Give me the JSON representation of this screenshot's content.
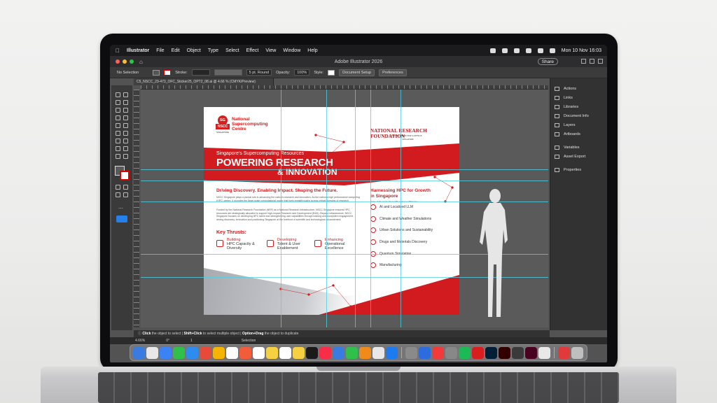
{
  "menubar": {
    "app_name": "Illustrator",
    "items": [
      "File",
      "Edit",
      "Object",
      "Type",
      "Select",
      "Effect",
      "View",
      "Window",
      "Help"
    ],
    "datetime": "Mon 10 Nov  16:03"
  },
  "window": {
    "title": "Adobe Illustrator 2026",
    "share_label": "Share"
  },
  "controlbar": {
    "selection": "No Selection",
    "stroke_label": "Stroke:",
    "brush": "5 pt. Round",
    "opacity_label": "Opacity:",
    "opacity_value": "100%",
    "style_label": "Style:",
    "document_setup": "Document Setup",
    "preferences": "Preferences"
  },
  "document": {
    "tab_name": "C5_NSCC_23-473_OFC_Sticker25_OPT2_08.ai @ 4.66 % (CMYK/Preview)"
  },
  "artboard": {
    "logo_badge": "SG",
    "logo_box": "NSCC",
    "logo_text": "National Supercomputing Centre",
    "logo_sub": "SINGAPORE",
    "partner": "NATIONAL RESEARCH FOUNDATION",
    "partner_sub": "PRIME MINISTER'S OFFICE",
    "partner_sub2": "SINGAPORE",
    "band_sub": "Singapore's Supercomputing Resources",
    "band_title1": "POWERING RESEARCH",
    "band_title2": "& INNOVATION",
    "left_heading": "Driving Discovery. Enabling Impact. Shaping the Future.",
    "para1": "NSCC Singapore plays a pivotal role in advancing the nation's research and innovation. As the national high performance computing (HPC) centre, it provides the large-scale computational power that fuels breakthroughs across critical domains of research.",
    "para2": "Funded by the National Research Foundation (NRF) as a National Research Infrastructure, NSCC Singapore ensures HPC resources are strategically allocated to support high-impact Research and Development (R&D). Beyond infrastructure, NSCC Singapore focuses on developing HPC talent and strengthening user capabilities through training and ecosystem engagement - driving discovery, innovation and positioning Singapore at the forefront of scientific and technological advancement.",
    "key_thrusts": "Key Thrusts:",
    "thrusts": [
      {
        "verb": "Building",
        "rest": "HPC Capacity & Diversity"
      },
      {
        "verb": "Developing",
        "rest": "Talent & User Enablement"
      },
      {
        "verb": "Enhancing",
        "rest": "Operational Excellence"
      }
    ],
    "right_heading1": "Harnessing HPC for Growth",
    "right_heading2": "in Singapore",
    "right_sub": "Some of the areas where HPC makes a difference:",
    "areas": [
      "AI and Localised LLM",
      "Climate and Weather Simulations",
      "Urban Solutions and Sustainability",
      "Drugs and Materials Discovery",
      "Quantum Simulation",
      "Manufacturing"
    ]
  },
  "panel": {
    "items": [
      "Actions",
      "Links",
      "Libraries",
      "Document Info",
      "Layers",
      "Artboards",
      "Variables",
      "Asset Export",
      "Properties"
    ]
  },
  "statusbar": {
    "hint_click": "Click",
    "hint_click_rest": "the object to select |",
    "hint_shift": "Shift+Click",
    "hint_shift_rest": "to select multiple object |",
    "hint_option": "Option+Drag",
    "hint_option_rest": "the object to duplicate",
    "zoom": "4.66%",
    "rotation": "0°",
    "artboard_num": "1",
    "mode": "Selection"
  },
  "dock": {
    "colors": [
      "#3a7be0",
      "#e8e8e8",
      "#3b82f6",
      "#2fbf4a",
      "#2d8cf0",
      "#e84a3a",
      "#f4b400",
      "#ffffff",
      "#f25c3a",
      "#ffffff",
      "#f5d042",
      "#ffffff",
      "#f5d042",
      "#1a1a1a",
      "#fa2d48",
      "#3a7be0",
      "#2fbf4a",
      "#f08a1a",
      "#e8e8e8",
      "#1d7bf0",
      "#8a8a8a",
      "#2d6cdf",
      "#f23a3a",
      "#888888",
      "#1db954",
      "#d81e1e",
      "#001e36",
      "#330000",
      "#3a3a3a",
      "#49021f",
      "#e8e8e8",
      "#e23a3a",
      "#bfbfbf"
    ]
  },
  "colors": {
    "brand_red": "#d21b1f",
    "guide": "#4fd0e0"
  }
}
